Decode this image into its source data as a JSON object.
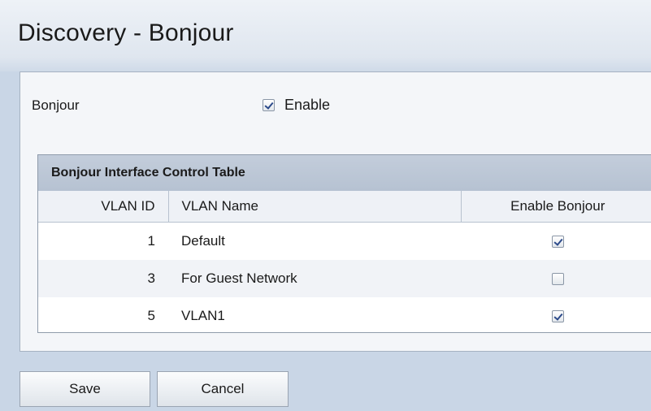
{
  "page": {
    "title": "Discovery - Bonjour"
  },
  "bonjour": {
    "label": "Bonjour",
    "enable_label": "Enable",
    "enabled": true
  },
  "table": {
    "caption": "Bonjour Interface Control Table",
    "columns": [
      "VLAN ID",
      "VLAN Name",
      "Enable Bonjour"
    ],
    "rows": [
      {
        "vlan_id": "1",
        "vlan_name": "Default",
        "enable_bonjour": true
      },
      {
        "vlan_id": "3",
        "vlan_name": "For Guest Network",
        "enable_bonjour": false
      },
      {
        "vlan_id": "5",
        "vlan_name": "VLAN1",
        "enable_bonjour": true
      }
    ]
  },
  "buttons": {
    "save": "Save",
    "cancel": "Cancel"
  }
}
